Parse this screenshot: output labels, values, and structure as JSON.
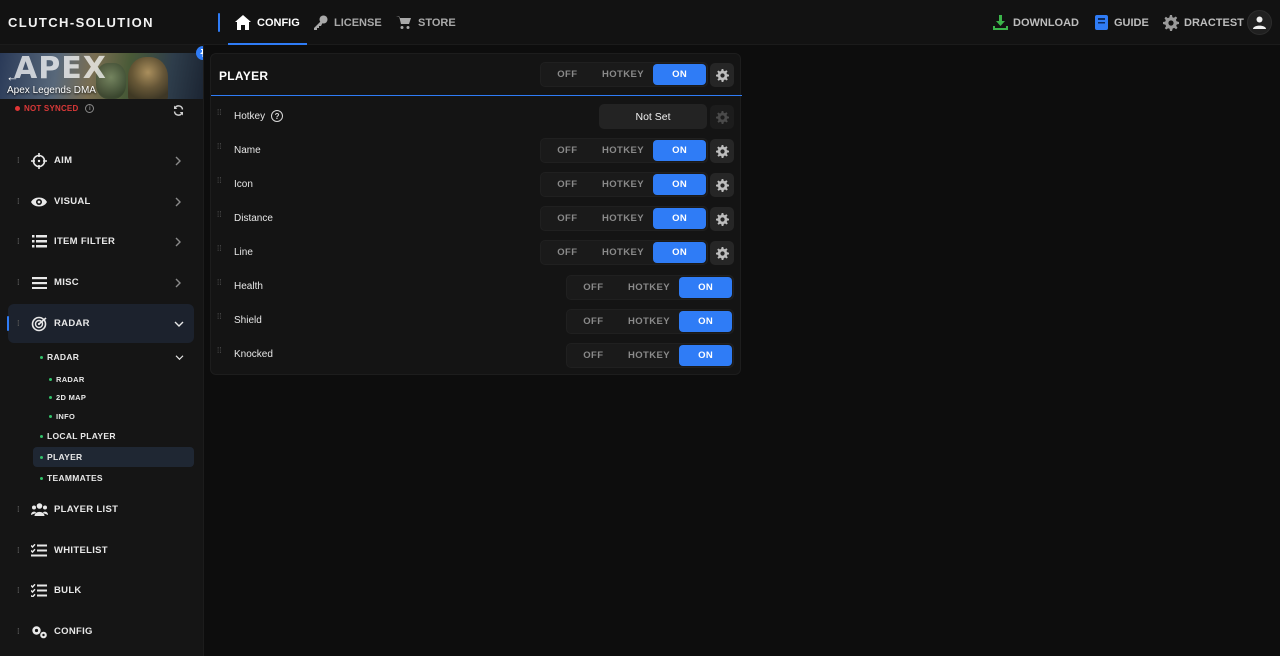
{
  "brand": "CLUTCH-SOLUTION",
  "nav": {
    "config": "CONFIG",
    "license": "LICENSE",
    "store": "STORE"
  },
  "right_nav": {
    "download": "DOWNLOAD",
    "guide": "GUIDE",
    "user": "DRACTEST"
  },
  "banner": {
    "game_logo": "APEX",
    "subtitle": "Apex Legends DMA"
  },
  "sync_status": "NOT SYNCED",
  "sidebar": {
    "items": [
      {
        "label": "AIM",
        "icon": "crosshair-icon"
      },
      {
        "label": "VISUAL",
        "icon": "eye-icon"
      },
      {
        "label": "ITEM FILTER",
        "icon": "list-icon"
      },
      {
        "label": "MISC",
        "icon": "menu-icon"
      },
      {
        "label": "RADAR",
        "icon": "radar-icon"
      },
      {
        "label": "PLAYER LIST",
        "icon": "users-icon"
      },
      {
        "label": "WHITELIST",
        "icon": "checklist-icon"
      },
      {
        "label": "BULK",
        "icon": "checklist-icon"
      },
      {
        "label": "CONFIG",
        "icon": "gears-icon"
      }
    ],
    "radar_sub": {
      "group": "RADAR",
      "children": [
        "RADAR",
        "2D MAP",
        "INFO"
      ],
      "local_player": "LOCAL PLAYER",
      "player": "PLAYER",
      "teammates": "TEAMMATES"
    }
  },
  "panel": {
    "title": "PLAYER",
    "toggle": {
      "off": "OFF",
      "hotkey": "HOTKEY",
      "on": "ON",
      "selected": "ON"
    },
    "hotkey_row": {
      "label": "Hotkey",
      "value": "Not Set"
    },
    "rows": [
      {
        "label": "Name",
        "state": "ON",
        "has_settings": true
      },
      {
        "label": "Icon",
        "state": "ON",
        "has_settings": true
      },
      {
        "label": "Distance",
        "state": "ON",
        "has_settings": true
      },
      {
        "label": "Line",
        "state": "ON",
        "has_settings": true
      },
      {
        "label": "Health",
        "state": "ON",
        "has_settings": false
      },
      {
        "label": "Shield",
        "state": "ON",
        "has_settings": false
      },
      {
        "label": "Knocked",
        "state": "ON",
        "has_settings": false
      }
    ]
  },
  "colors": {
    "accent": "#2f7cf6",
    "status_red": "#e03535",
    "sub_dot_green": "#33c26a",
    "download_green": "#3bb54a"
  }
}
